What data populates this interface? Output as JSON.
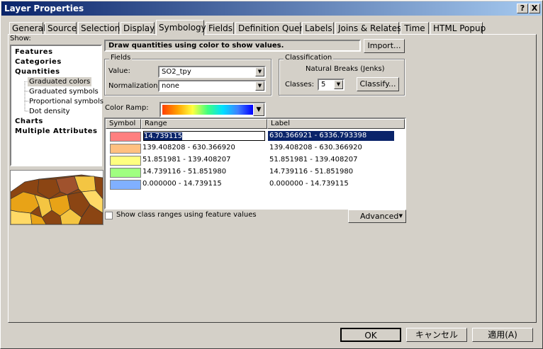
{
  "window": {
    "title": "Layer Properties",
    "help_label": "?",
    "close_label": "X"
  },
  "tabs": [
    "General",
    "Source",
    "Selection",
    "Display",
    "Symbology",
    "Fields",
    "Definition Query",
    "Labels",
    "Joins & Relates",
    "Time",
    "HTML Popup"
  ],
  "active_tab": "Symbology",
  "show": {
    "label": "Show:",
    "tree": [
      {
        "label": "Features",
        "bold": true
      },
      {
        "label": "Categories",
        "bold": true
      },
      {
        "label": "Quantities",
        "bold": true
      },
      {
        "label": "Graduated colors",
        "bold": false,
        "selected": true
      },
      {
        "label": "Graduated symbols",
        "bold": false
      },
      {
        "label": "Proportional symbols",
        "bold": false
      },
      {
        "label": "Dot density",
        "bold": false
      },
      {
        "label": "Charts",
        "bold": true
      },
      {
        "label": "Multiple Attributes",
        "bold": true
      }
    ]
  },
  "description": "Draw quantities using color to show values.",
  "import_button": "Import...",
  "fields": {
    "title": "Fields",
    "value_label": "Value:",
    "value": "SO2_tpy",
    "normalization_label": "Normalization:",
    "normalization": "none"
  },
  "classification": {
    "title": "Classification",
    "method": "Natural Breaks (Jenks)",
    "classes_label": "Classes:",
    "classes": "5",
    "classify_button": "Classify..."
  },
  "color_ramp_label": "Color Ramp:",
  "table": {
    "headers": [
      "Symbol",
      "Range",
      "Label"
    ],
    "rows": [
      {
        "color": "#ff8080",
        "range": "14.739115",
        "label": "630.366921 - 6336.793398",
        "selected": true
      },
      {
        "color": "#ffc080",
        "range": "139.408208 - 630.366920",
        "label": "139.408208 - 630.366920"
      },
      {
        "color": "#ffff80",
        "range": "51.851981 - 139.408207",
        "label": "51.851981 - 139.408207"
      },
      {
        "color": "#a0ff80",
        "range": "14.739116 - 51.851980",
        "label": "14.739116 - 51.851980"
      },
      {
        "color": "#80b0ff",
        "range": "0.000000 - 14.739115",
        "label": "0.000000 - 14.739115"
      }
    ]
  },
  "show_class_ranges_label": "Show class ranges using feature values",
  "advanced_button": "Advanced",
  "ok_button": "OK",
  "cancel_button": "キャンセル",
  "apply_button": "適用(A)"
}
